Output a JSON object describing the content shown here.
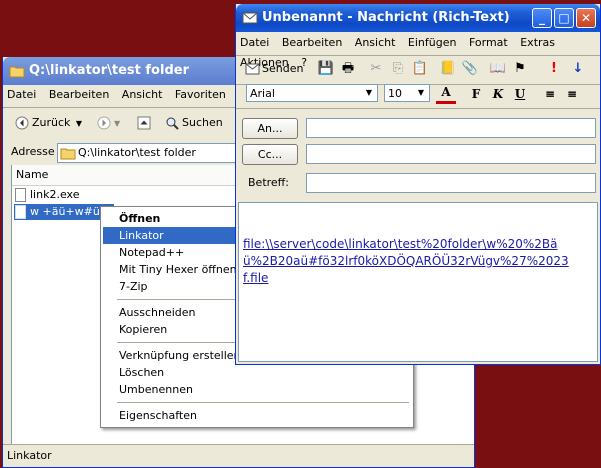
{
  "explorer": {
    "title": "Q:\\linkator\\test folder",
    "menu": [
      "Datei",
      "Bearbeiten",
      "Ansicht",
      "Favoriten"
    ],
    "toolbar": {
      "back_label": "Zurück",
      "search_label": "Suchen"
    },
    "address_label": "Adresse",
    "address_value": "Q:\\linkator\\test folder",
    "column_name": "Name",
    "files": [
      "link2.exe",
      "w +äü+w#üöf"
    ],
    "status_text": "Linkator"
  },
  "context_menu": {
    "items": [
      "Öffnen",
      "Linkator",
      "Notepad++",
      "Mit Tiny Hexer öffnen",
      "7-Zip",
      "Ausschneiden",
      "Kopieren",
      "Verknüpfung erstellen",
      "Löschen",
      "Umbenennen",
      "Eigenschaften"
    ]
  },
  "message": {
    "title": "Unbenannt - Nachricht (Rich-Text)",
    "menu": [
      "Datei",
      "Bearbeiten",
      "Ansicht",
      "Einfügen",
      "Format",
      "Extras",
      "Aktionen",
      "?"
    ],
    "send_label": "Senden",
    "font": "Arial",
    "size": "10",
    "to_label": "An...",
    "cc_label": "Cc...",
    "subject_label": "Betreff:",
    "body_link": "file:\\\\server\\code\\linkator\\test%20folder\\w%20%2Bäü%2B20aü#fö32lrf0köXDÖQARÖÜ32rVügv%27%2023f.file"
  },
  "icons": [
    "folder-icon",
    "mail-icon",
    "send-icon",
    "save-icon",
    "print-icon",
    "cut-icon",
    "copy-icon",
    "paste-icon",
    "address-book-icon",
    "attach-icon",
    "check-names-icon",
    "flag-icon",
    "importance-high-icon",
    "importance-low-icon",
    "font-color-icon",
    "align-left-icon",
    "align-center-icon"
  ],
  "colors": {
    "desktop": "#7a0f12",
    "selection": "#316ac5",
    "titlebar": "#1f5fd6",
    "link": "#1a1aa6"
  }
}
